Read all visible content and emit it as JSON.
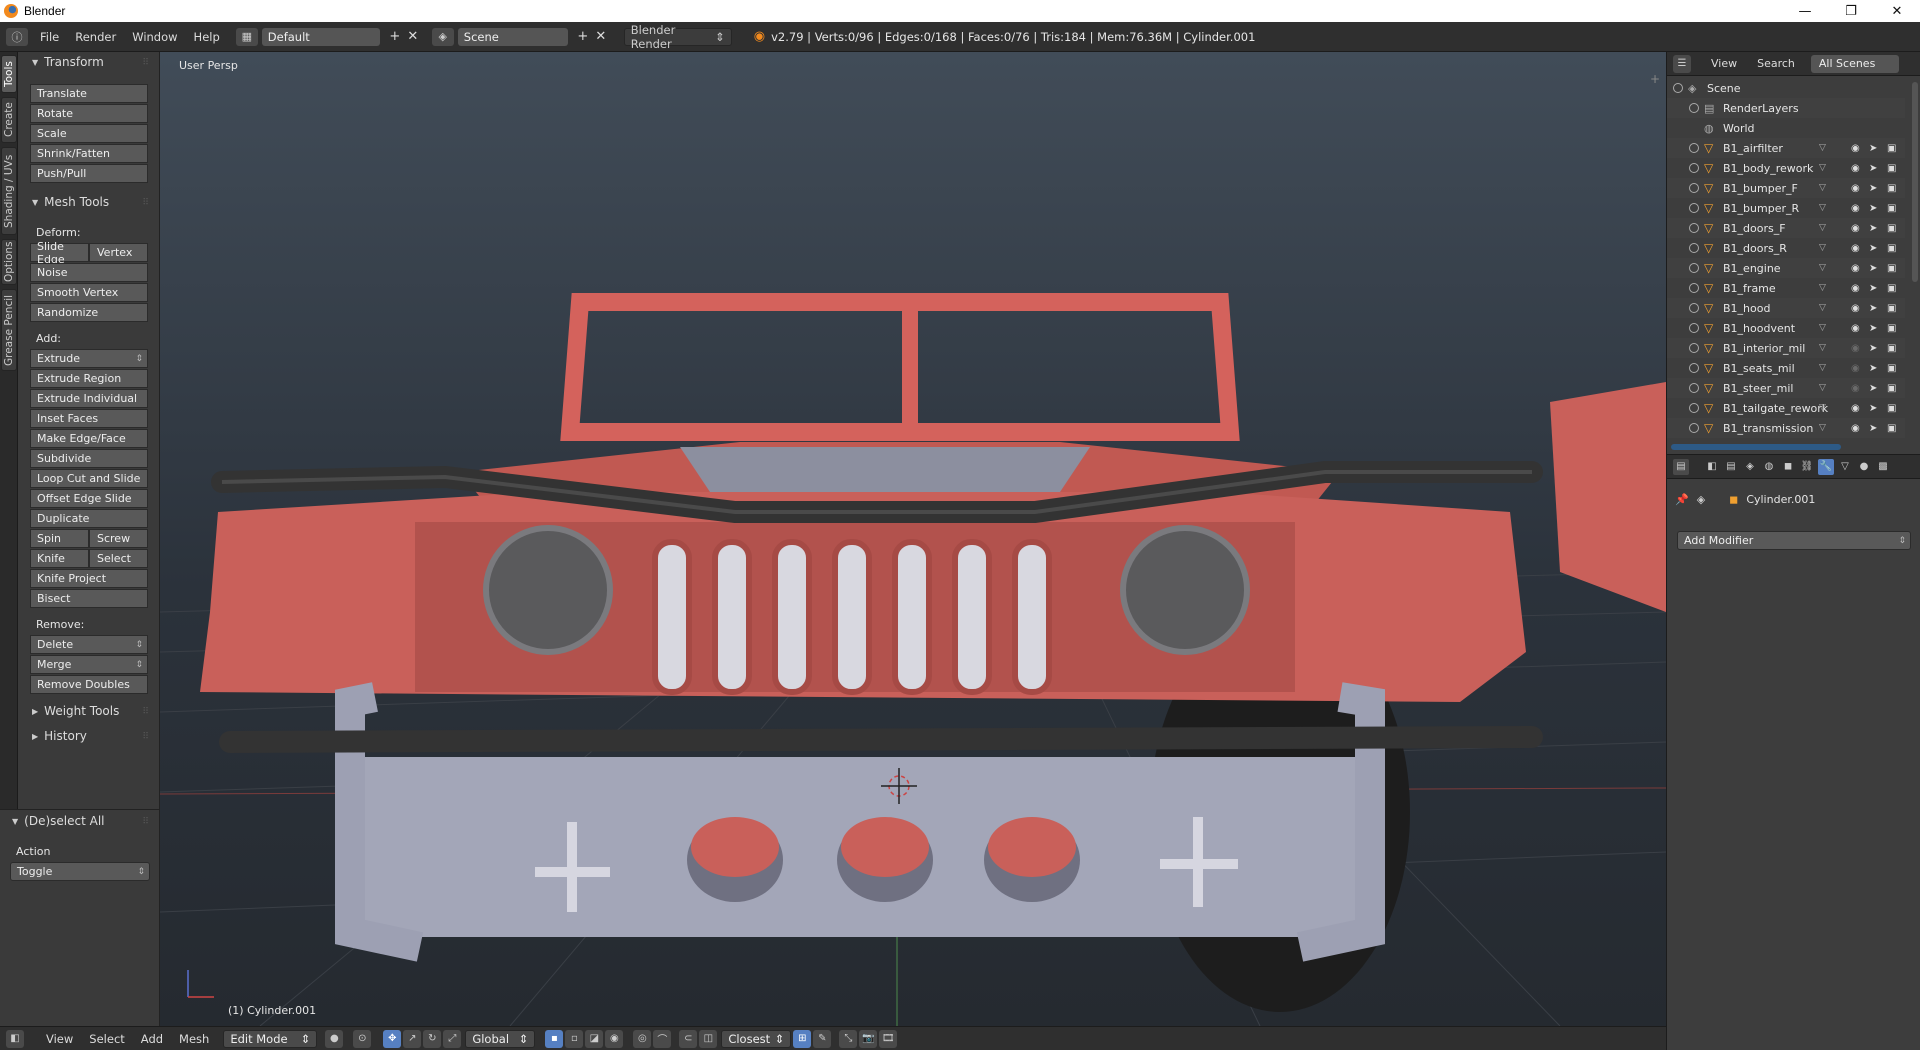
{
  "window": {
    "title": "Blender",
    "minimize": "—",
    "maximize": "❐",
    "close": "✕"
  },
  "topbar": {
    "menus": [
      "File",
      "Render",
      "Window",
      "Help"
    ],
    "layout": "Default",
    "scene": "Scene",
    "engine": "Blender Render",
    "stats": "v2.79 | Verts:0/96 | Edges:0/168 | Faces:0/76 | Tris:184 | Mem:76.36M | Cylinder.001"
  },
  "vtabs": [
    "Tools",
    "Create",
    "Shading / UVs",
    "Options",
    "Grease Pencil"
  ],
  "toolshelf": {
    "transform": {
      "header": "Transform",
      "buttons": [
        "Translate",
        "Rotate",
        "Scale",
        "Shrink/Fatten",
        "Push/Pull"
      ]
    },
    "mesh_tools": {
      "header": "Mesh Tools",
      "deform_label": "Deform:",
      "slide_edge": "Slide Edge",
      "vertex": "Vertex",
      "deform_buttons": [
        "Noise",
        "Smooth Vertex",
        "Randomize"
      ],
      "add_label": "Add:",
      "extrude": "Extrude",
      "add_buttons": [
        "Extrude Region",
        "Extrude Individual",
        "Inset Faces",
        "Make Edge/Face",
        "Subdivide",
        "Loop Cut and Slide",
        "Offset Edge Slide",
        "Duplicate"
      ],
      "spin": "Spin",
      "screw": "Screw",
      "knife": "Knife",
      "select": "Select",
      "knife_project": "Knife Project",
      "bisect": "Bisect",
      "remove_label": "Remove:",
      "delete": "Delete",
      "merge": "Merge",
      "remove_doubles": "Remove Doubles"
    },
    "weight_tools": "Weight Tools",
    "history": "History"
  },
  "operator": {
    "header": "(De)select All",
    "action_label": "Action",
    "action_value": "Toggle"
  },
  "viewport": {
    "label": "User Persp",
    "object": "(1) Cylinder.001"
  },
  "bottombar": {
    "menus": [
      "View",
      "Select",
      "Add",
      "Mesh"
    ],
    "mode": "Edit Mode",
    "orientation": "Global",
    "snap": "Closest"
  },
  "outliner": {
    "menus": [
      "View",
      "Search"
    ],
    "scope": "All Scenes",
    "scene": "Scene",
    "render_layers": "RenderLayers",
    "world": "World",
    "objects": [
      {
        "name": "B1_airfilter",
        "visible": true
      },
      {
        "name": "B1_body_rework",
        "visible": true
      },
      {
        "name": "B1_bumper_F",
        "visible": true
      },
      {
        "name": "B1_bumper_R",
        "visible": true
      },
      {
        "name": "B1_doors_F",
        "visible": true
      },
      {
        "name": "B1_doors_R",
        "visible": true
      },
      {
        "name": "B1_engine",
        "visible": true
      },
      {
        "name": "B1_frame",
        "visible": true
      },
      {
        "name": "B1_hood",
        "visible": true
      },
      {
        "name": "B1_hoodvent",
        "visible": true
      },
      {
        "name": "B1_interior_mil",
        "visible": false
      },
      {
        "name": "B1_seats_mil",
        "visible": false
      },
      {
        "name": "B1_steer_mil",
        "visible": false
      },
      {
        "name": "B1_tailgate_rework",
        "visible": true
      },
      {
        "name": "B1_transmission",
        "visible": true
      }
    ]
  },
  "properties": {
    "object": "Cylinder.001",
    "add_modifier": "Add Modifier"
  },
  "colors": {
    "accent": "#5680c2",
    "body": "#c9605a",
    "metal": "#a3a6b8",
    "object_icon": "#f0a030"
  }
}
